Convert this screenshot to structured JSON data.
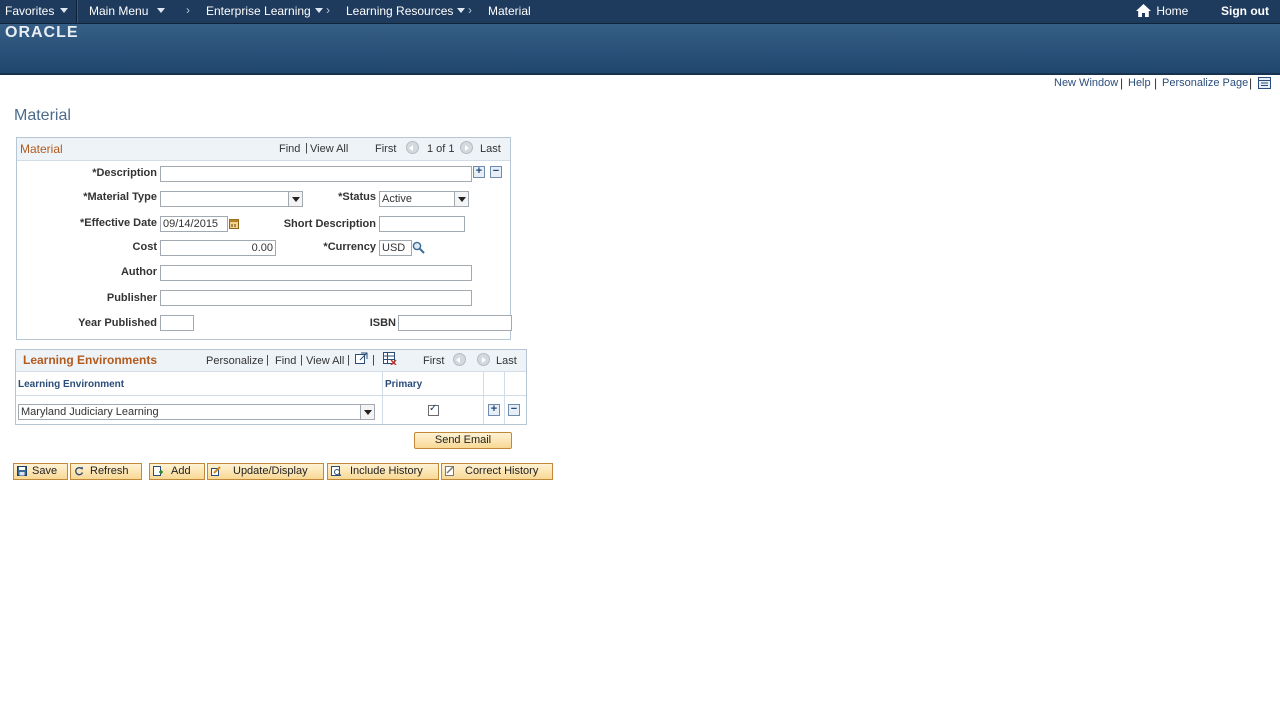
{
  "nav": {
    "favorites": "Favorites",
    "main_menu": "Main Menu",
    "sep": "›",
    "enterprise_learning": "Enterprise Learning",
    "learning_resources": "Learning Resources",
    "material": "Material",
    "home": "Home",
    "sign_out": "Sign out"
  },
  "brand": {
    "logo": "ORACLE"
  },
  "page_links": {
    "new_window": "New Window",
    "help": "Help",
    "personalize_page": "Personalize Page",
    "separator": "|"
  },
  "page_title": "Material",
  "material_box": {
    "title": "Material",
    "find": "Find",
    "view_all": "View All",
    "first": "First",
    "count": "1 of 1",
    "last": "Last",
    "fields": {
      "description_label": "*Description",
      "description_value": "",
      "material_type_label": "*Material Type",
      "material_type_value": "",
      "status_label": "*Status",
      "status_value": "Active",
      "effective_date_label": "*Effective Date",
      "effective_date_value": "09/14/2015",
      "short_description_label": "Short Description",
      "short_description_value": "",
      "cost_label": "Cost",
      "cost_value": "0.00",
      "currency_label": "*Currency",
      "currency_value": "USD",
      "author_label": "Author",
      "author_value": "",
      "publisher_label": "Publisher",
      "publisher_value": "",
      "year_published_label": "Year Published",
      "year_published_value": "",
      "isbn_label": "ISBN",
      "isbn_value": ""
    }
  },
  "learning_env": {
    "title": "Learning Environments",
    "personalize": "Personalize",
    "find": "Find",
    "view_all": "View All",
    "first": "First",
    "last": "Last",
    "col_environment": "Learning Environment",
    "col_primary": "Primary",
    "rows": [
      {
        "environment": "Maryland Judiciary Learning",
        "primary": true
      }
    ]
  },
  "send_email": "Send Email",
  "toolbar": {
    "save": "Save",
    "refresh": "Refresh",
    "add": "Add",
    "update_display": "Update/Display",
    "include_history": "Include History",
    "correct_history": "Correct History"
  },
  "colors": {
    "nav_bg": "#1e3a5c",
    "banner": "#2c5278",
    "section_title": "#b35a1d",
    "link": "#2b4d7a",
    "button": "#f8d894"
  }
}
